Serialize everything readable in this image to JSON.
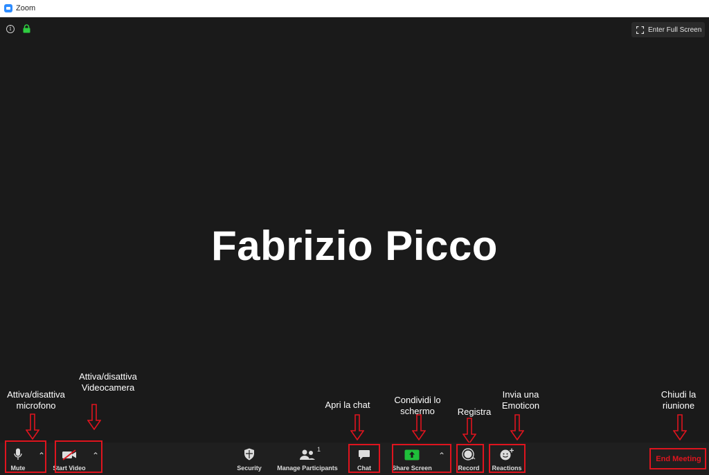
{
  "window": {
    "title": "Zoom"
  },
  "stage": {
    "participant_name": "Fabrizio Picco",
    "fullscreen_label": "Enter Full Screen"
  },
  "annotations": {
    "mic": [
      "Attiva/disattiva",
      "microfono"
    ],
    "video": [
      "Attiva/disattiva",
      "Videocamera"
    ],
    "chat": [
      "Apri la chat"
    ],
    "share": [
      "Condividi lo",
      "schermo"
    ],
    "record": [
      "Registra"
    ],
    "reactions": [
      "Invia una",
      "Emoticon"
    ],
    "end": [
      "Chiudi la",
      "riunione"
    ]
  },
  "toolbar": {
    "mute": "Mute",
    "start_video": "Start Video",
    "security": "Security",
    "manage_participants": "Manage Participants",
    "participants_count": "1",
    "chat": "Chat",
    "share_screen": "Share Screen",
    "record": "Record",
    "reactions": "Reactions",
    "end_meeting": "End Meeting"
  },
  "colors": {
    "annotation_red": "#e0141e",
    "share_green": "#1fbf3a",
    "lock_green": "#2ecc40",
    "zoom_blue": "#2d8cff"
  }
}
